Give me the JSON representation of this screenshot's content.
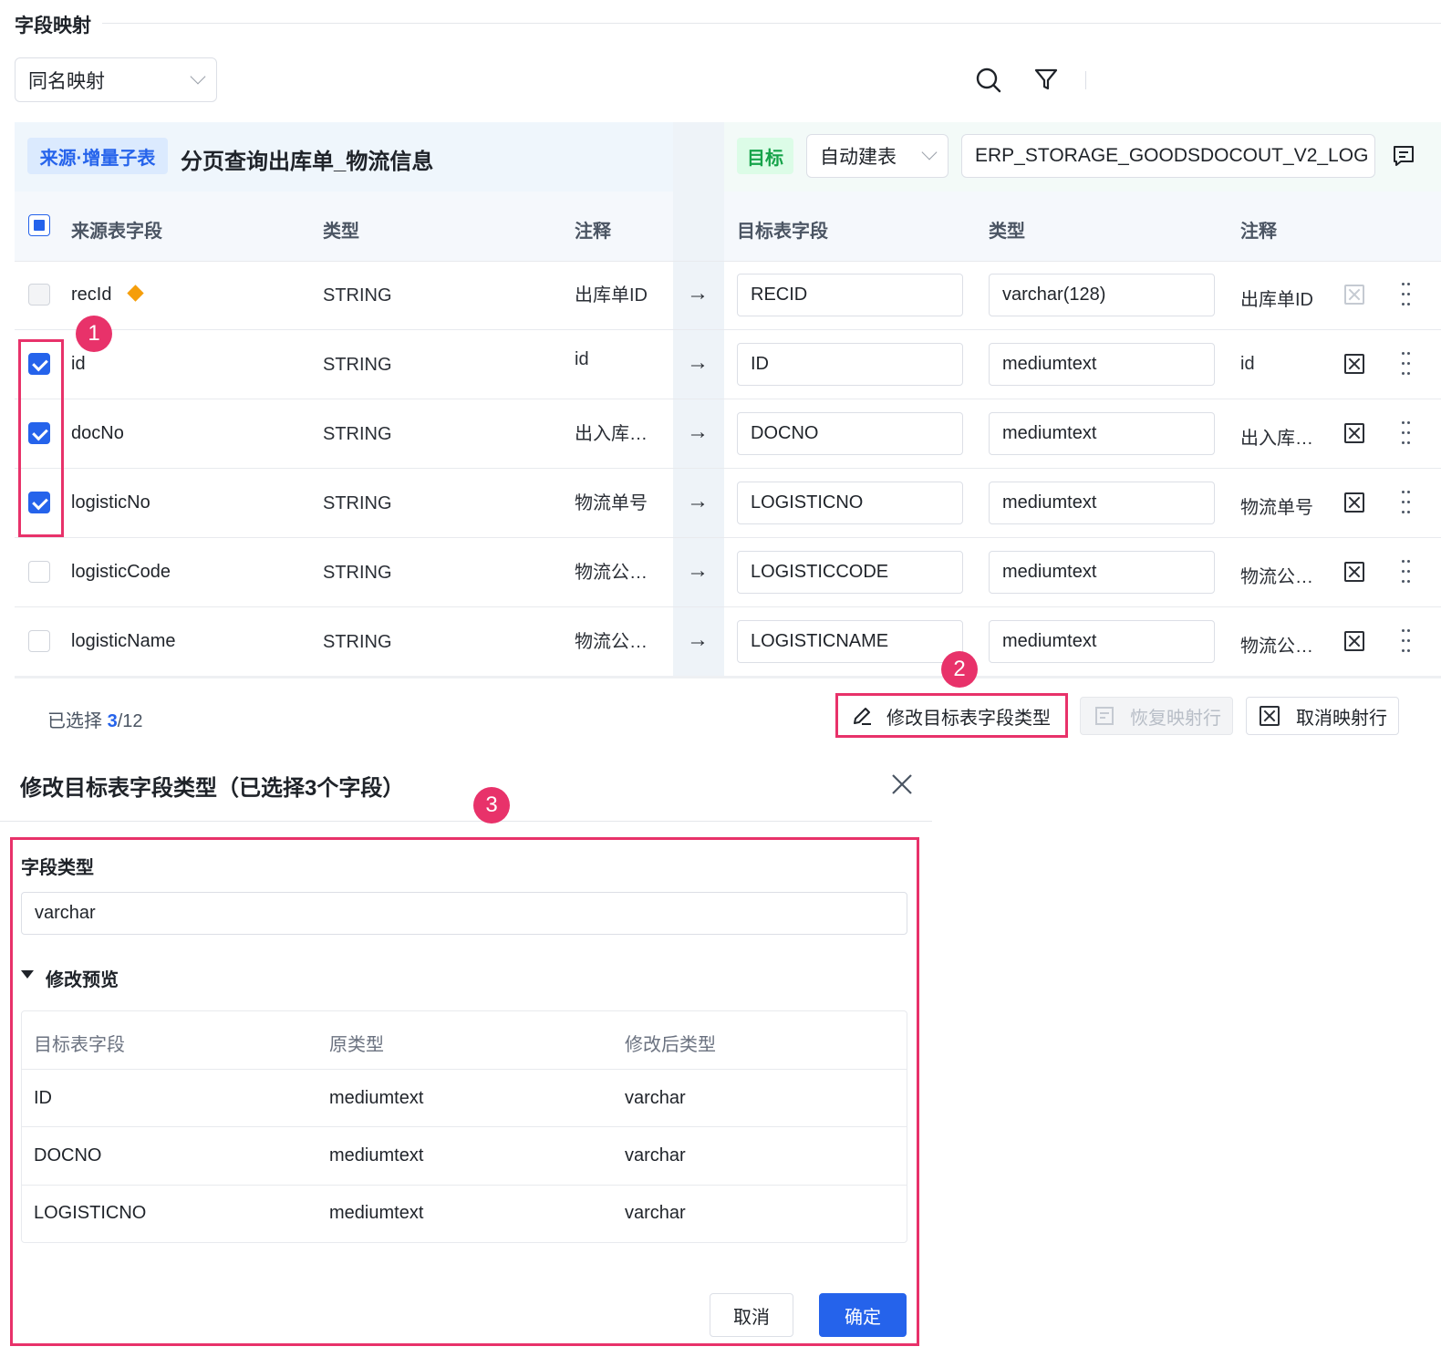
{
  "header": {
    "title": "字段映射",
    "mapping_mode": "同名映射"
  },
  "source": {
    "tag": "来源·增量子表",
    "name": "分页查询出库单_物流信息",
    "columns": [
      "来源表字段",
      "类型",
      "注释"
    ]
  },
  "target": {
    "tag": "目标",
    "create_mode": "自动建表",
    "table_name": "ERP_STORAGE_GOODSDOCOUT_V2_LOG",
    "columns": [
      "目标表字段",
      "类型",
      "注释"
    ]
  },
  "rows": [
    {
      "field": "recId",
      "type": "STRING",
      "note": "出库单ID",
      "arrow": "→",
      "target_field": "RECID",
      "target_type": "varchar(128)",
      "target_note": "出库单ID",
      "checked": false,
      "primary": true
    },
    {
      "field": "id",
      "type": "STRING",
      "note": "id",
      "arrow": "→",
      "target_field": "ID",
      "target_type": "mediumtext",
      "target_note": "id",
      "checked": true
    },
    {
      "field": "docNo",
      "type": "STRING",
      "note": "出入库…",
      "arrow": "→",
      "target_field": "DOCNO",
      "target_type": "mediumtext",
      "target_note": "出入库…",
      "checked": true
    },
    {
      "field": "logisticNo",
      "type": "STRING",
      "note": "物流单号",
      "arrow": "→",
      "target_field": "LOGISTICNO",
      "target_type": "mediumtext",
      "target_note": "物流单号",
      "checked": true
    },
    {
      "field": "logisticCode",
      "type": "STRING",
      "note": "物流公…",
      "arrow": "→",
      "target_field": "LOGISTICCODE",
      "target_type": "mediumtext",
      "target_note": "物流公…",
      "checked": false
    },
    {
      "field": "logisticName",
      "type": "STRING",
      "note": "物流公…",
      "arrow": "→",
      "target_field": "LOGISTICNAME",
      "target_type": "mediumtext",
      "target_note": "物流公…",
      "checked": false
    }
  ],
  "footer": {
    "selected_label": "已选择",
    "selected_count": "3",
    "total": "/12",
    "modify_type_button": "修改目标表字段类型",
    "restore_button": "恢复映射行",
    "cancel_mapping_button": "取消映射行"
  },
  "badges": [
    "1",
    "2",
    "3"
  ],
  "dialog": {
    "title": "修改目标表字段类型（已选择3个字段）",
    "field_type_label": "字段类型",
    "field_type_value": "varchar",
    "preview_label": "修改预览",
    "preview_columns": [
      "目标表字段",
      "原类型",
      "修改后类型"
    ],
    "preview_rows": [
      {
        "field": "ID",
        "old": "mediumtext",
        "new": "varchar"
      },
      {
        "field": "DOCNO",
        "old": "mediumtext",
        "new": "varchar"
      },
      {
        "field": "LOGISTICNO",
        "old": "mediumtext",
        "new": "varchar"
      }
    ],
    "cancel_button": "取消",
    "confirm_button": "确定"
  },
  "colors": {
    "accent": "#2563eb",
    "highlight": "#e8326a",
    "source_tag_bg": "#dbeafe",
    "target_tag_bg": "#dcfce7"
  }
}
